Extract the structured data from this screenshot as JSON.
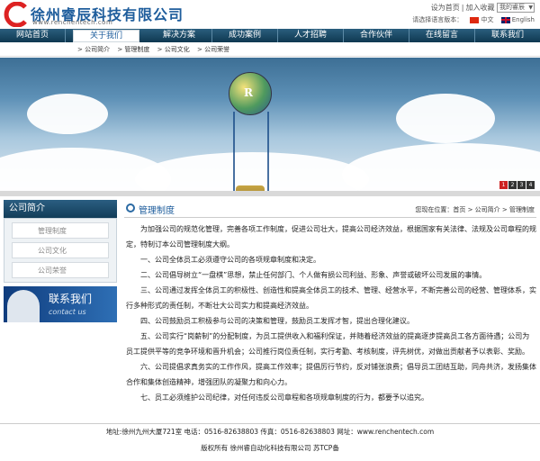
{
  "header": {
    "company_name": "徐州睿辰科技有限公司",
    "url": "www.renchentech.com",
    "links": [
      "设为首页",
      "加入收藏"
    ],
    "search_value": "我的睿辰",
    "lang_prompt": "请选择语言版本：",
    "lang_cn": "中文",
    "lang_en": "English"
  },
  "nav": {
    "items": [
      "网站首页",
      "关于我们",
      "解决方案",
      "成功案例",
      "人才招聘",
      "合作伙伴",
      "在线留言",
      "联系我们"
    ],
    "active_index": 1
  },
  "subnav": [
    "> 公司简介",
    "> 管理制度",
    "> 公司文化",
    "> 公司荣誉"
  ],
  "banner": {
    "balloon_letter": "R",
    "pager": [
      "1",
      "2",
      "3",
      "4"
    ],
    "pager_active": 0
  },
  "sidebar": {
    "title": "公司简介",
    "items": [
      "管理制度",
      "公司文化",
      "公司荣誉"
    ],
    "contact_cn": "联系我们",
    "contact_en": "contact us"
  },
  "content": {
    "title": "管理制度",
    "crumb": "您现在位置：首页 > 公司简介 > 管理制度",
    "paragraphs": [
      "为加强公司的规范化管理，完善各项工作制度，促进公司壮大，提高公司经济效益，根据国家有关法律、法规及公司章程的规定，特制订本公司管理制度大纲。",
      "一、公司全体员工必须遵守公司的各项规章制度和决定。",
      "二、公司倡导树立“一盘棋”思想，禁止任何部门、个人做有损公司利益、形象、声誉或破坏公司发展的事情。",
      "三、公司通过发挥全体员工的积极性、创造性和提高全体员工的技术、管理、经营水平，不断完善公司的经营、管理体系，实行多种形式的责任制，不断壮大公司实力和提高经济效益。",
      "四、公司鼓励员工积极参与公司的决策和管理，鼓励员工发挥才智，提出合理化建议。",
      "五、公司实行“岗薪制”的分配制度，为员工提供收入和福利保证，并随着经济效益的提高逐步提高员工各方面待遇；公司为员工提供平等的竞争环境和晋升机会；公司推行岗位责任制，实行考勤、考核制度，评先树优，对做出贡献者予以表彰、奖励。",
      "六、公司提倡求真务实的工作作风，提高工作效率；提倡厉行节约，反对铺张浪费；倡导员工团结互助，同舟共济，发扬集体合作和集体创造精神，增强团队的凝聚力和向心力。",
      "七、员工必须维护公司纪律，对任何违反公司章程和各项规章制度的行为，都要予以追究。"
    ]
  },
  "footer": {
    "line1": "地址:徐州九州大厦721室 电话：0516-82638803  传真：0516-82638803  网址：www.renchentech.com",
    "line2": "版权所有  徐州睿自动化科技有限公司  苏TCP备"
  },
  "colors": {
    "brand": "#1e5d9c",
    "nav_bg": "#0f3850"
  }
}
